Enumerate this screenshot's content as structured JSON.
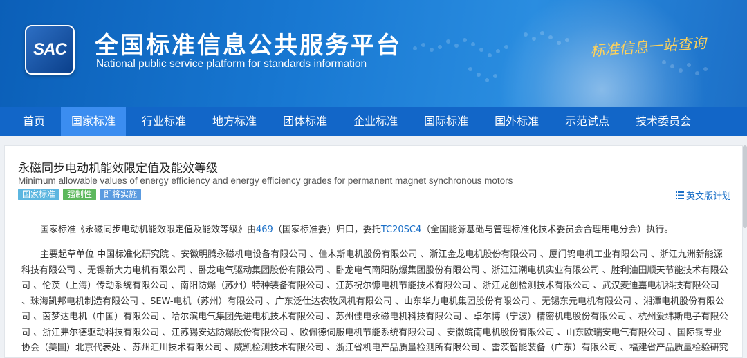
{
  "header": {
    "logo_text": "SAC",
    "title": "全国标准信息公共服务平台",
    "subtitle": "National public service platform  for standards information",
    "slogan": "标准信息一站查询"
  },
  "nav": [
    {
      "label": "首页",
      "active": false
    },
    {
      "label": "国家标准",
      "active": true
    },
    {
      "label": "行业标准",
      "active": false
    },
    {
      "label": "地方标准",
      "active": false
    },
    {
      "label": "团体标准",
      "active": false
    },
    {
      "label": "企业标准",
      "active": false
    },
    {
      "label": "国际标准",
      "active": false
    },
    {
      "label": "国外标准",
      "active": false
    },
    {
      "label": "示范试点",
      "active": false
    },
    {
      "label": "技术委员会",
      "active": false
    }
  ],
  "standard": {
    "title_cn": "永磁同步电动机能效限定值及能效等级",
    "title_en": "Minimum allowable values of energy efficiency and energy efficiency grades for permanent magnet synchronous motors",
    "badges": [
      "国家标准",
      "强制性",
      "即将实施"
    ],
    "en_plan_label": "英文版计划",
    "intro_prefix": "国家标准《永磁同步电动机能效限定值及能效等级》由",
    "committee_code": "469",
    "intro_mid": "（国家标准委）归口，委托",
    "tc_code": "TC20SC4",
    "intro_suffix": "（全国能源基础与管理标准化技术委员会合理用电分会）执行。",
    "drafters": "主要起草单位 中国标准化研究院 、安徽明腾永磁机电设备有限公司 、佳木斯电机股份有限公司 、浙江金龙电机股份有限公司 、厦门钨电机工业有限公司 、浙江九洲新能源科技有限公司 、无锡新大力电机有限公司 、卧龙电气驱动集团股份有限公司 、卧龙电气南阳防爆集团股份有限公司 、浙江江潮电机实业有限公司 、胜利油田顺天节能技术有限公司 、伦茨（上海）传动系统有限公司 、南阳防爆（苏州）特种装备有限公司 、江苏祝尔慷电机节能技术有限公司 、浙江龙创检测技术有限公司 、武汉麦迪嘉电机科技有限公司 、珠海凯邦电机制造有限公司 、SEW-电机（苏州）有限公司 、广东泛仕达农牧风机有限公司 、山东华力电机集团股份有限公司 、无锡东元电机有限公司 、湘潭电机股份有限公司 、茵梦达电机（中国）有限公司 、哈尔滨电气集团先进电机技术有限公司 、苏州佳电永磁电机科技有限公司 、卓尔博（宁波）精密机电股份有限公司 、杭州爱纬斯电子有限公司 、浙江弗尔德驱动科技有限公司 、江苏锡安达防爆股份有限公司 、欧佩德伺服电机节能系统有限公司 、安徽皖南电机股份有限公司 、山东欧瑞安电气有限公司 、国际铜专业协会（美国）北京代表处 、苏州汇川技术有限公司 、威凯检测技术有限公司 、浙江省机电产品质量检测所有限公司 、雷茨智能装备（广东）有限公司 、福建省产品质量检验研究院"
  },
  "colors": {
    "nav_bg": "#1266c8",
    "nav_active": "#3b8df0",
    "link": "#1a6fc7",
    "badge_national": "#5cb6e0",
    "badge_mandatory": "#5cb85c",
    "badge_upcoming": "#5b9be0"
  }
}
